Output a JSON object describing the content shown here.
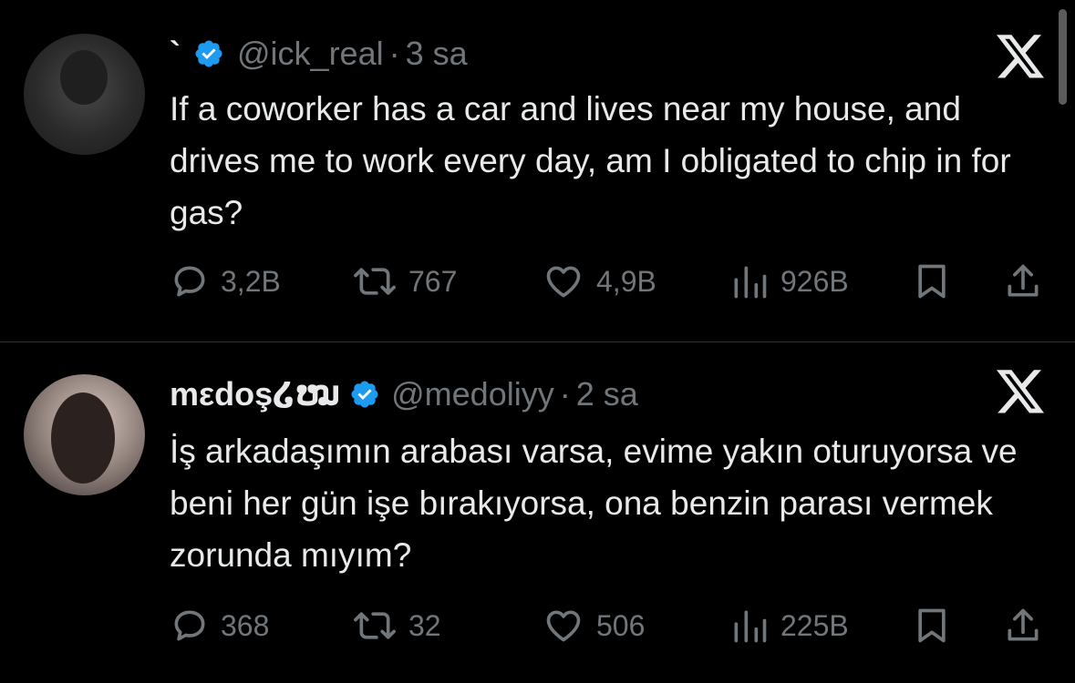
{
  "tweets": [
    {
      "display_name": "`",
      "handle": "@ick_real",
      "separator": "·",
      "time": "3 sa",
      "text": "If a coworker has a car and lives near my house, and drives me to work every day, am I obligated to chip in for gas?",
      "replies": "3,2B",
      "retweets": "767",
      "likes": "4,9B",
      "views": "926B"
    },
    {
      "display_name": "mεdoş໒ໝ",
      "handle": "@medoliyy",
      "separator": "·",
      "time": "2 sa",
      "text": "İş arkadaşımın arabası varsa, evime yakın oturuyorsa ve beni her gün işe bırakıyorsa, ona benzin parası vermek zorunda mıyım?",
      "replies": "368",
      "retweets": "32",
      "likes": "506",
      "views": "225B"
    }
  ],
  "colors": {
    "background": "#000000",
    "text": "#e7e9ea",
    "secondary": "#71767b",
    "verified": "#1d9bf0",
    "divider": "#2f3336"
  }
}
